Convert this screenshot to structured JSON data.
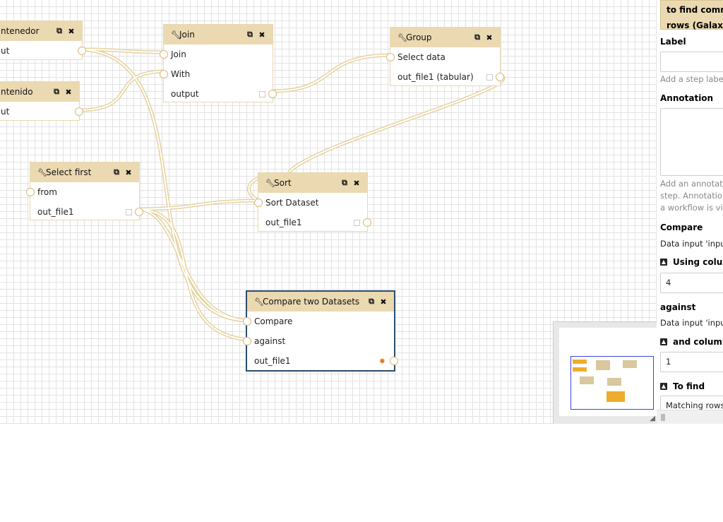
{
  "nodes": {
    "contenedor": {
      "title": "ntenedor",
      "output": "ut"
    },
    "contenido": {
      "title": "ntenido",
      "output": "ut"
    },
    "join": {
      "title": "Join",
      "inputs": [
        "Join",
        "With"
      ],
      "output": "output"
    },
    "group": {
      "title": "Group",
      "input": "Select data",
      "output": "out_file1 (tabular)"
    },
    "select_first": {
      "title": "Select first",
      "input": "from",
      "output": "out_file1"
    },
    "sort": {
      "title": "Sort",
      "input": "Sort Dataset",
      "output": "out_file1"
    },
    "compare": {
      "title": "Compare two Datasets",
      "inputs": [
        "Compare",
        "against"
      ],
      "output": "out_file1"
    }
  },
  "icons": {
    "wrench": "wrench-icon",
    "copy": "copy-icon",
    "close": "close-icon",
    "settings": "gear-icon"
  },
  "colors": {
    "node_header": "#ebd9b2",
    "wire": "#e8d6a8",
    "active_border": "#2a4d6e",
    "minimap_view": "#3b42e0",
    "minimap_active": "#eeac2c"
  },
  "panel": {
    "title_line1": "to find comm",
    "title_line2": "rows (Galaxy",
    "label_heading": "Label",
    "label_help": "Add a step labe",
    "annotation_heading": "Annotation",
    "annotation_help": [
      "Add an annotat",
      "step. Annotatio",
      "a workflow is vi"
    ],
    "compare_heading": "Compare",
    "compare_text": "Data input 'inpu",
    "using_column_label": "Using colum",
    "using_column_value": "4",
    "against_heading": "against",
    "against_text": "Data input 'inpu",
    "and_column_label": "and column",
    "and_column_value": "1",
    "to_find_label": "To find",
    "to_find_value": "Matching rows"
  }
}
